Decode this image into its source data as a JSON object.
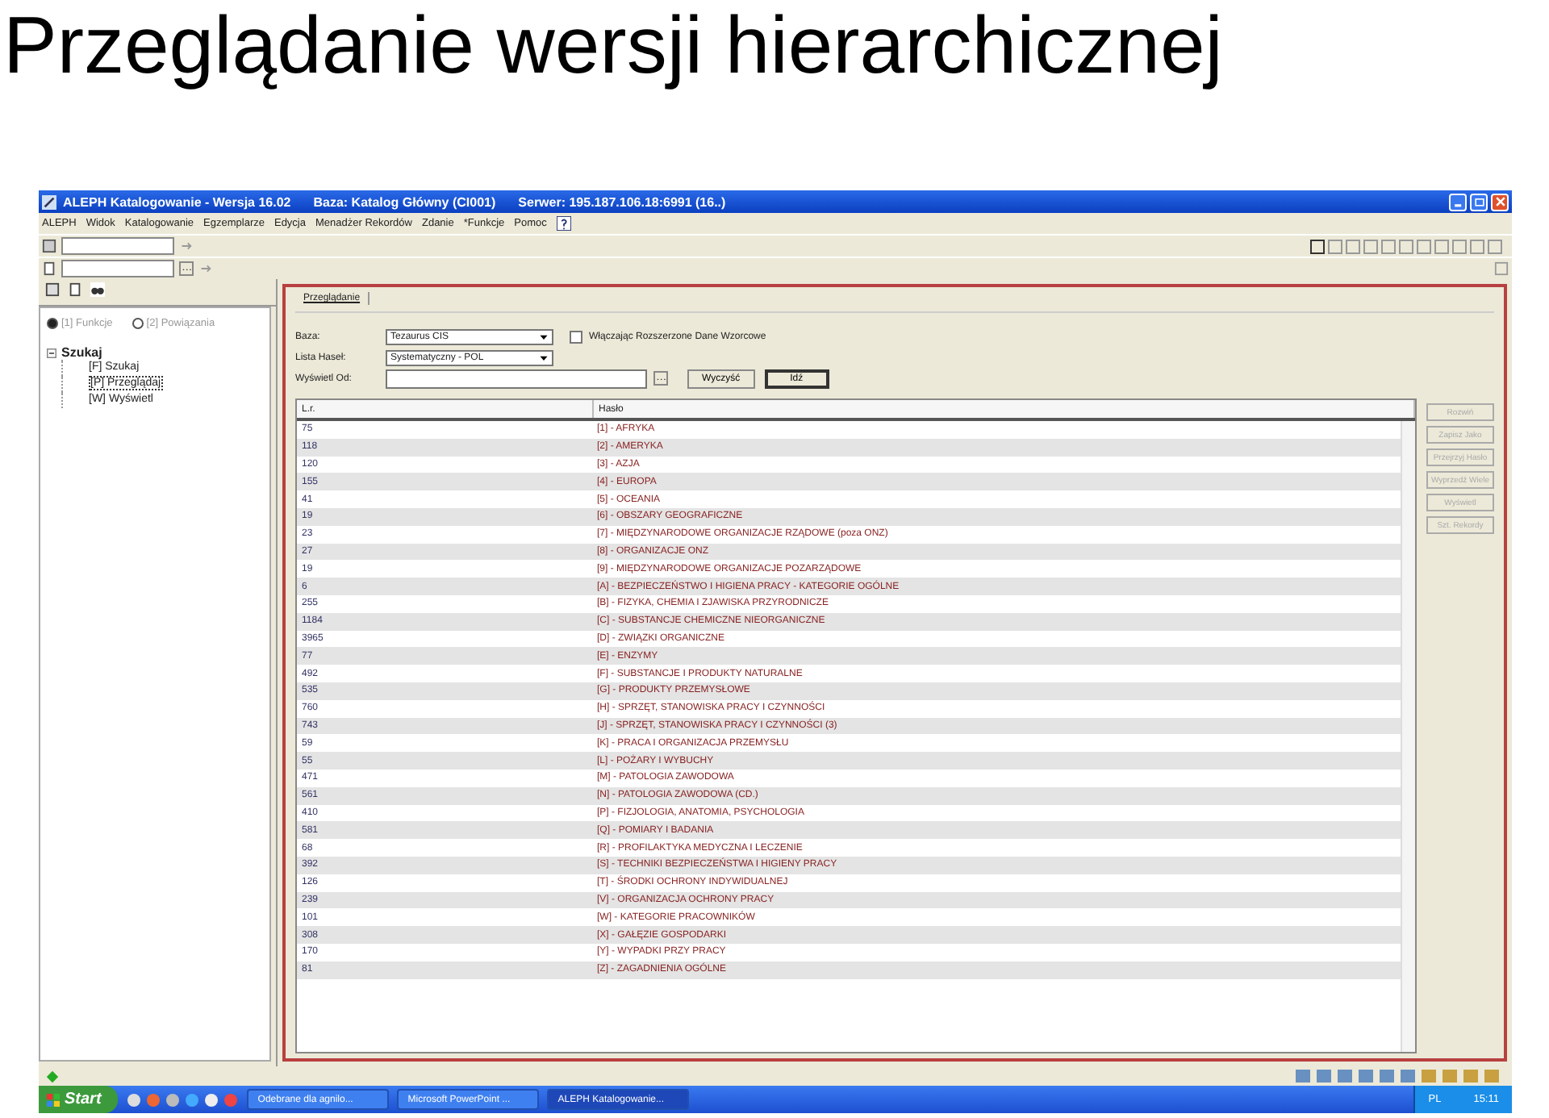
{
  "slide_title": "Przeglądanie wersji hierarchicznej",
  "window": {
    "title": "ALEPH Katalogowanie - Wersja 16.02",
    "database": "Baza: Katalog Główny (CI001)",
    "server": "Serwer: 195.187.106.18:6991 (16..)"
  },
  "menu": [
    "ALEPH",
    "Widok",
    "Katalogowanie",
    "Egzemplarze",
    "Edycja",
    "Menadżer Rekordów",
    "Zdanie",
    "*Funkcje",
    "Pomoc"
  ],
  "left_panel": {
    "radios": [
      {
        "label": "[1] Funkcje",
        "selected": true
      },
      {
        "label": "[2] Powiązania",
        "selected": false
      }
    ],
    "tree": [
      {
        "label": "Szukaj",
        "expanded": true,
        "children": [
          {
            "label": "[F] Szukaj",
            "selected": false
          },
          {
            "label": "[P] Przeglądaj",
            "selected": true
          },
          {
            "label": "[W] Wyświetl",
            "selected": false
          }
        ]
      }
    ]
  },
  "tab": "Przeglądanie",
  "form": {
    "base_label": "Baza:",
    "base_value": "Tezaurus CIS",
    "checkbox": {
      "label": "Włączając Rozszerzone Dane Wzorcowe",
      "checked": false
    },
    "list_label": "Lista Haseł:",
    "list_value": "Systematyczny - POL",
    "from_label": "Wyświetl Od:",
    "buttons": [
      "Wyczyść",
      "Idź"
    ]
  },
  "table": {
    "columns": [
      "L.r.",
      "Hasło"
    ],
    "rows": [
      [
        "75",
        "[1] - AFRYKA"
      ],
      [
        "118",
        "[2] - AMERYKA"
      ],
      [
        "120",
        "[3] - AZJA"
      ],
      [
        "155",
        "[4] - EUROPA"
      ],
      [
        "41",
        "[5] - OCEANIA"
      ],
      [
        "19",
        "[6] - OBSZARY GEOGRAFICZNE"
      ],
      [
        "23",
        "[7] - MIĘDZYNARODOWE ORGANIZACJE RZĄDOWE (poza ONZ)"
      ],
      [
        "27",
        "[8] - ORGANIZACJE ONZ"
      ],
      [
        "19",
        "[9] - MIĘDZYNARODOWE ORGANIZACJE POZARZĄDOWE"
      ],
      [
        "6",
        "[A] - BEZPIECZEŃSTWO I HIGIENA PRACY - KATEGORIE OGÓLNE"
      ],
      [
        "255",
        "[B] - FIZYKA, CHEMIA I ZJAWISKA PRZYRODNICZE"
      ],
      [
        "1184",
        "[C] - SUBSTANCJE CHEMICZNE NIEORGANICZNE"
      ],
      [
        "3965",
        "[D] - ZWIĄZKI ORGANICZNE"
      ],
      [
        "77",
        "[E] - ENZYMY"
      ],
      [
        "492",
        "[F] - SUBSTANCJE I PRODUKTY NATURALNE"
      ],
      [
        "535",
        "[G] - PRODUKTY PRZEMYSŁOWE"
      ],
      [
        "760",
        "[H] - SPRZĘT, STANOWISKA PRACY I CZYNNOŚCI"
      ],
      [
        "743",
        "[J] - SPRZĘT, STANOWISKA PRACY I CZYNNOŚCI (3)"
      ],
      [
        "59",
        "[K] - PRACA I ORGANIZACJA PRZEMYSŁU"
      ],
      [
        "55",
        "[L] - POŻARY I WYBUCHY"
      ],
      [
        "471",
        "[M] - PATOLOGIA ZAWODOWA"
      ],
      [
        "561",
        "[N] - PATOLOGIA ZAWODOWA (CD.)"
      ],
      [
        "410",
        "[P] - FIZJOLOGIA, ANATOMIA, PSYCHOLOGIA"
      ],
      [
        "581",
        "[Q] - POMIARY I BADANIA"
      ],
      [
        "68",
        "[R] - PROFILAKTYKA MEDYCZNA I LECZENIE"
      ],
      [
        "392",
        "[S] - TECHNIKI BEZPIECZEŃSTWA I HIGIENY PRACY"
      ],
      [
        "126",
        "[T] - ŚRODKI OCHRONY INDYWIDUALNEJ"
      ],
      [
        "239",
        "[V] - ORGANIZACJA OCHRONY PRACY"
      ],
      [
        "101",
        "[W] - KATEGORIE PRACOWNIKÓW"
      ],
      [
        "308",
        "[X] - GAŁĘZIE GOSPODARKI"
      ],
      [
        "170",
        "[Y] - WYPADKI PRZY PRACY"
      ],
      [
        "81",
        "[Z] - ZAGADNIENIA OGÓLNE"
      ]
    ]
  },
  "side_buttons": [
    {
      "label": "Rozwiń",
      "disabled": true
    },
    {
      "label": "Zapisz Jako",
      "disabled": true
    },
    {
      "label": "Przejrzyj Hasło",
      "disabled": true
    },
    {
      "label": "Wyprzedź Wiele",
      "disabled": true
    },
    {
      "label": "Wyświetl",
      "disabled": true
    },
    {
      "label": "Szt. Rekordy",
      "disabled": true
    }
  ],
  "taskbar": {
    "start": "Start",
    "tasks": [
      {
        "label": "Odebrane dla agnilo...",
        "selected": false
      },
      {
        "label": "Microsoft PowerPoint ...",
        "selected": false
      },
      {
        "label": "ALEPH Katalogowanie...",
        "selected": true
      }
    ],
    "language": "PL",
    "clock": "15:11"
  }
}
